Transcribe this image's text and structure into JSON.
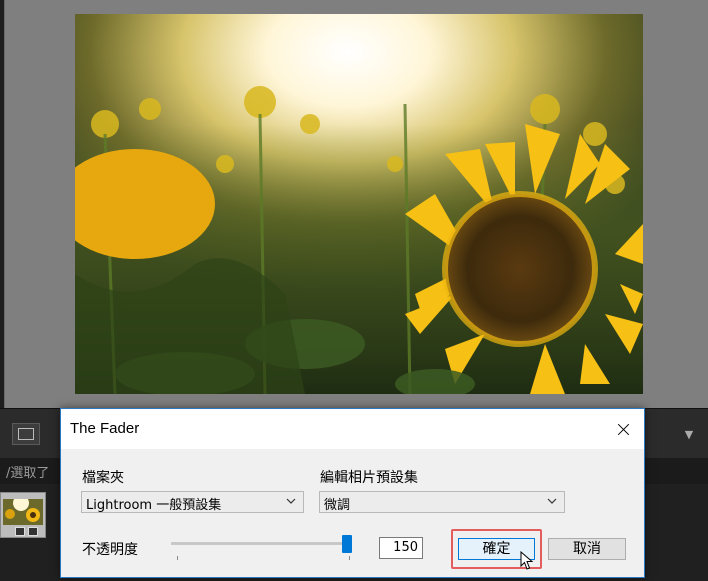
{
  "toolbar": {
    "menu_glyph": "▼"
  },
  "filmstrip": {
    "label": "/選取了"
  },
  "dialog": {
    "title": "The Fader",
    "folder_label": "檔案夾",
    "folder_value": "Lightroom 一般預設集",
    "preset_label": "編輯相片預設集",
    "preset_value": "微調",
    "opacity_label": "不透明度",
    "opacity_value": "150",
    "opacity_level_fraction": 0.98,
    "ok_label": "確定",
    "cancel_label": "取消"
  },
  "colors": {
    "accent": "#0078d7",
    "highlight": "#e35d5d"
  },
  "icons": [
    "close-icon",
    "chevron-down-icon",
    "mouse-cursor-icon",
    "view-mode-icon"
  ]
}
